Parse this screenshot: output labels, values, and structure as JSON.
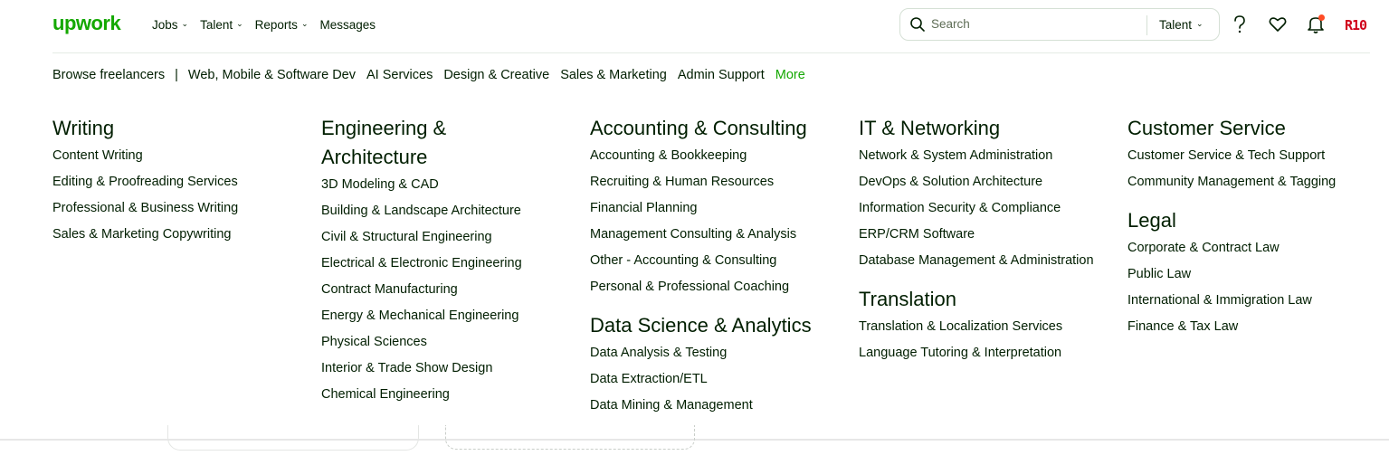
{
  "header": {
    "logo": "upwork",
    "nav": [
      {
        "label": "Jobs",
        "has_menu": true
      },
      {
        "label": "Talent",
        "has_menu": true
      },
      {
        "label": "Reports",
        "has_menu": true
      },
      {
        "label": "Messages",
        "has_menu": false
      }
    ],
    "search": {
      "placeholder": "Search",
      "scope": "Talent"
    },
    "avatar_text": "R10",
    "icons": [
      "help-icon",
      "heart-icon",
      "bell-icon"
    ],
    "accent_color": "#14a800",
    "notification_dot_color": "#ff4b25"
  },
  "browse": {
    "label": "Browse freelancers",
    "separator": "|",
    "links": [
      "Web, Mobile & Software Dev",
      "AI Services",
      "Design & Creative",
      "Sales & Marketing",
      "Admin Support"
    ],
    "more": "More"
  },
  "categories": [
    {
      "title": "Writing",
      "items": [
        "Content Writing",
        "Editing & Proofreading Services",
        "Professional & Business Writing",
        "Sales & Marketing Copywriting"
      ]
    },
    {
      "title": "Engineering & Architecture",
      "items": [
        "3D Modeling & CAD",
        "Building & Landscape Architecture",
        "Civil & Structural Engineering",
        "Electrical & Electronic Engineering",
        "Contract Manufacturing",
        "Energy & Mechanical Engineering",
        "Physical Sciences",
        "Interior & Trade Show Design",
        "Chemical Engineering"
      ]
    },
    {
      "title": "Accounting & Consulting",
      "items": [
        "Accounting & Bookkeeping",
        "Recruiting & Human Resources",
        "Financial Planning",
        "Management Consulting & Analysis",
        "Other - Accounting & Consulting",
        "Personal & Professional Coaching"
      ]
    },
    {
      "title": "Data Science & Analytics",
      "items": [
        "Data Analysis & Testing",
        "Data Extraction/ETL",
        "Data Mining & Management"
      ]
    },
    {
      "title": "IT & Networking",
      "items": [
        "Network & System Administration",
        "DevOps & Solution Architecture",
        "Information Security & Compliance",
        "ERP/CRM Software",
        "Database Management & Administration"
      ]
    },
    {
      "title": "Translation",
      "items": [
        "Translation & Localization Services",
        "Language Tutoring & Interpretation"
      ]
    },
    {
      "title": "Customer Service",
      "items": [
        "Customer Service & Tech Support",
        "Community Management & Tagging"
      ]
    },
    {
      "title": "Legal",
      "items": [
        "Corporate & Contract Law",
        "Public Law",
        "International & Immigration Law",
        "Finance & Tax Law"
      ]
    }
  ]
}
